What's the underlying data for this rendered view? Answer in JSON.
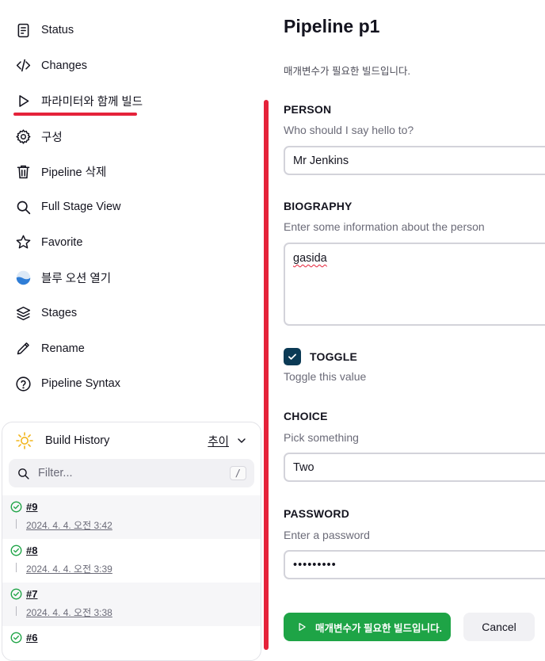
{
  "sidebar": {
    "items": [
      {
        "label": "Status",
        "icon": "document-icon"
      },
      {
        "label": "Changes",
        "icon": "code-icon"
      },
      {
        "label": "파라미터와 함께 빌드",
        "icon": "play-icon",
        "active": true
      },
      {
        "label": "구성",
        "icon": "gear-icon"
      },
      {
        "label": "Pipeline 삭제",
        "icon": "trash-icon"
      },
      {
        "label": "Full Stage View",
        "icon": "search-icon"
      },
      {
        "label": "Favorite",
        "icon": "star-icon"
      },
      {
        "label": "블루 오션 열기",
        "icon": "blue-ocean-icon"
      },
      {
        "label": "Stages",
        "icon": "layers-icon"
      },
      {
        "label": "Rename",
        "icon": "pencil-icon"
      },
      {
        "label": "Pipeline Syntax",
        "icon": "help-circle-icon"
      }
    ],
    "active_color": "#e5223a"
  },
  "history": {
    "title": "Build History",
    "trend_label": "추이",
    "filter_placeholder": "Filter...",
    "filter_shortcut": "/",
    "builds": [
      {
        "number": "#9",
        "date": "2024. 4. 4. 오전 3:42",
        "status": "success"
      },
      {
        "number": "#8",
        "date": "2024. 4. 4. 오전 3:39",
        "status": "success"
      },
      {
        "number": "#7",
        "date": "2024. 4. 4. 오전 3:38",
        "status": "success"
      },
      {
        "number": "#6",
        "date": "",
        "status": "success"
      }
    ]
  },
  "main": {
    "title": "Pipeline p1",
    "description": "매개변수가 필요한 빌드입니다.",
    "params": {
      "person": {
        "name": "PERSON",
        "description": "Who should I say hello to?",
        "value": "Mr Jenkins"
      },
      "biography": {
        "name": "BIOGRAPHY",
        "description": "Enter some information about the person",
        "value": "gasida"
      },
      "toggle": {
        "name": "TOGGLE",
        "description": "Toggle this value",
        "checked": true
      },
      "choice": {
        "name": "CHOICE",
        "description": "Pick something",
        "value": "Two"
      },
      "password": {
        "name": "PASSWORD",
        "description": "Enter a password",
        "value": "•••••••••"
      }
    },
    "build_button": "매개변수가 필요한 빌드입니다.",
    "cancel_button": "Cancel"
  },
  "colors": {
    "accent_red": "#e5223a",
    "build_green": "#1ea446",
    "checkbox_navy": "#0b3a55"
  }
}
